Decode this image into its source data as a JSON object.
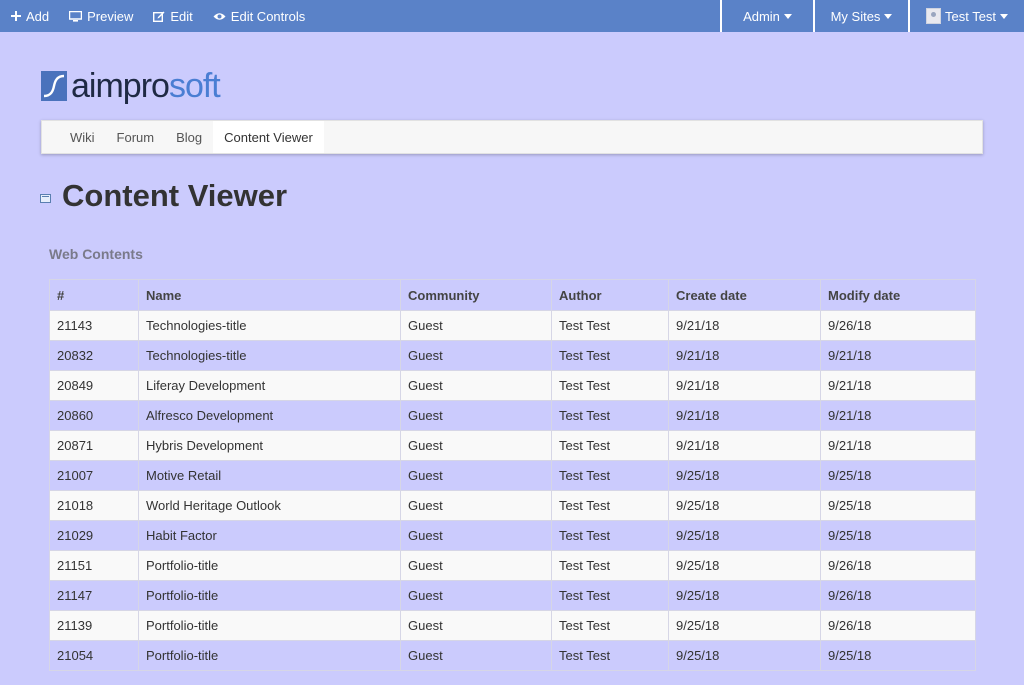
{
  "dockbar": {
    "add_label": "Add",
    "preview_label": "Preview",
    "edit_label": "Edit",
    "edit_controls_label": "Edit Controls",
    "admin_label": "Admin",
    "my_sites_label": "My Sites",
    "user_label": "Test Test"
  },
  "logo": {
    "part1": "aimpro",
    "part2": "soft"
  },
  "nav": {
    "items": [
      "Wiki",
      "Forum",
      "Blog",
      "Content Viewer"
    ],
    "active": "Content Viewer"
  },
  "page": {
    "title": "Content Viewer",
    "section": "Web Contents"
  },
  "table": {
    "headers": [
      "#",
      "Name",
      "Community",
      "Author",
      "Create date",
      "Modify date"
    ],
    "rows": [
      [
        "21143",
        "Technologies-title",
        "Guest",
        "Test Test",
        "9/21/18",
        "9/26/18"
      ],
      [
        "20832",
        "Technologies-title",
        "Guest",
        "Test Test",
        "9/21/18",
        "9/21/18"
      ],
      [
        "20849",
        "Liferay Development",
        "Guest",
        "Test Test",
        "9/21/18",
        "9/21/18"
      ],
      [
        "20860",
        "Alfresco Development",
        "Guest",
        "Test Test",
        "9/21/18",
        "9/21/18"
      ],
      [
        "20871",
        "Hybris Development",
        "Guest",
        "Test Test",
        "9/21/18",
        "9/21/18"
      ],
      [
        "21007",
        "Motive Retail",
        "Guest",
        "Test Test",
        "9/25/18",
        "9/25/18"
      ],
      [
        "21018",
        "World Heritage Outlook",
        "Guest",
        "Test Test",
        "9/25/18",
        "9/25/18"
      ],
      [
        "21029",
        "Habit Factor",
        "Guest",
        "Test Test",
        "9/25/18",
        "9/25/18"
      ],
      [
        "21151",
        "Portfolio-title",
        "Guest",
        "Test Test",
        "9/25/18",
        "9/26/18"
      ],
      [
        "21147",
        "Portfolio-title",
        "Guest",
        "Test Test",
        "9/25/18",
        "9/26/18"
      ],
      [
        "21139",
        "Portfolio-title",
        "Guest",
        "Test Test",
        "9/25/18",
        "9/26/18"
      ],
      [
        "21054",
        "Portfolio-title",
        "Guest",
        "Test Test",
        "9/25/18",
        "9/25/18"
      ]
    ]
  },
  "colors": {
    "dockbar": "#5a82c8",
    "background": "#cbcbfd",
    "logo_dark": "#1f2a44",
    "logo_blue": "#4a7ed3"
  },
  "icons": {
    "add": "plus-icon",
    "preview": "monitor-icon",
    "edit": "edit-icon",
    "edit_controls": "eye-icon",
    "title": "portlet-icon"
  }
}
